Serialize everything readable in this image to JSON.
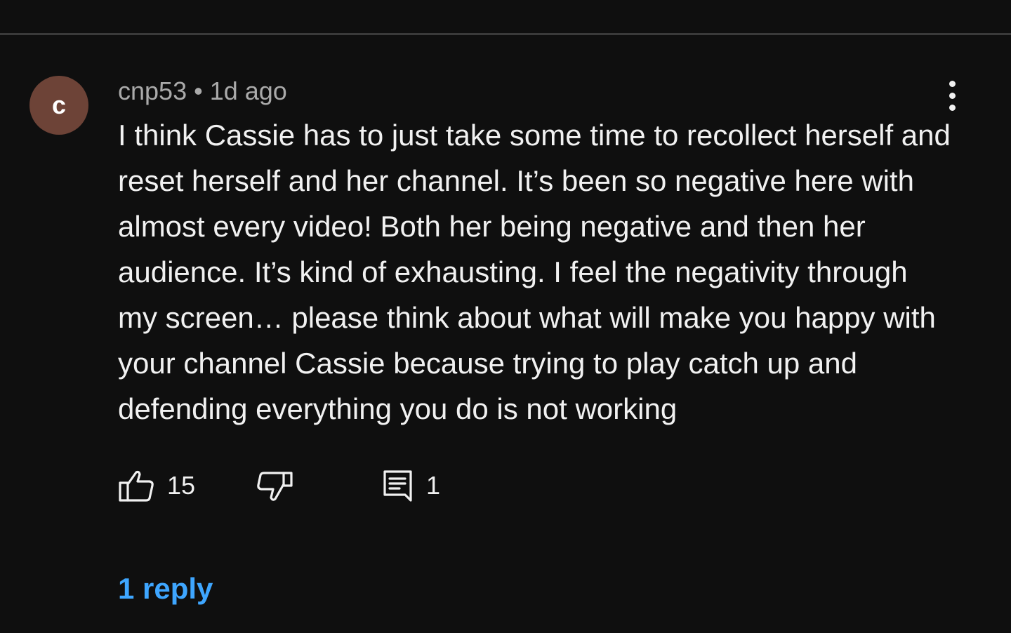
{
  "comment": {
    "avatar_letter": "c",
    "author": "cnp53",
    "separator": "•",
    "time": "1d ago",
    "text": "I think Cassie has to just take some time to recollect herself and reset herself and her channel. It’s been so negative here with almost every video! Both her being negative and then her audience. It’s kind of exhausting. I feel the negativity through my screen… please think about what will make you happy with your channel Cassie because trying to play catch up and defending everything you do is not working",
    "likes": "15",
    "reply_count": "1",
    "replies_link": "1 reply",
    "icons": {
      "menu": "more-vert-icon",
      "like": "thumb-up-icon",
      "dislike": "thumb-down-icon",
      "reply": "comment-icon"
    },
    "colors": {
      "background": "#0f0f0f",
      "avatar": "#6d4337",
      "link": "#3ea6ff"
    }
  }
}
